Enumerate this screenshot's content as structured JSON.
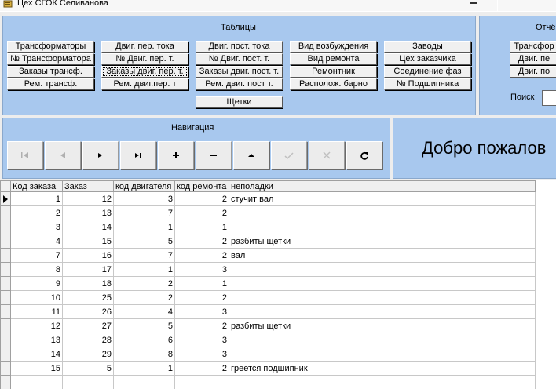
{
  "window": {
    "title": "Цех СГОК Селиванова"
  },
  "tables_group": {
    "title": "Таблицы",
    "buttons": [
      "Трансформаторы",
      "№ Трансформатора",
      "Заказы трансф.",
      "Рем. трансф.",
      "Двиг. пер. тока",
      "№ Двиг. пер. т.",
      "Заказы двиг. пер. т.",
      "Рем. двиг.пер. т",
      "Двиг. пост. тока",
      "№ Двиг. пост. т.",
      "Заказы двиг. пост. т.",
      "Рем. двиг. пост т.",
      "Вид возбуждения",
      "Вид ремонта",
      "Ремонтник",
      "Располож. барно",
      "Заводы",
      "Цех заказчика",
      "Соединение фаз",
      "№ Подшипника",
      "Щетки"
    ]
  },
  "reports_group": {
    "title": "Отчё",
    "buttons": [
      "Трансфор",
      "Двиг. пе",
      "Двиг. по"
    ],
    "search_label": "Поиск",
    "search_value": ""
  },
  "navigation": {
    "title": "Навигация",
    "buttons": [
      {
        "name": "first",
        "icon": "first-record-icon",
        "enabled": false
      },
      {
        "name": "prior",
        "icon": "prior-record-icon",
        "enabled": false
      },
      {
        "name": "next",
        "icon": "next-record-icon",
        "enabled": true
      },
      {
        "name": "last",
        "icon": "last-record-icon",
        "enabled": true
      },
      {
        "name": "insert",
        "icon": "plus-icon",
        "enabled": true
      },
      {
        "name": "delete",
        "icon": "minus-icon",
        "enabled": true
      },
      {
        "name": "edit",
        "icon": "edit-up-icon",
        "enabled": true
      },
      {
        "name": "post",
        "icon": "check-icon",
        "enabled": false
      },
      {
        "name": "cancel",
        "icon": "cancel-icon",
        "enabled": false
      },
      {
        "name": "refresh",
        "icon": "refresh-icon",
        "enabled": true
      }
    ]
  },
  "welcome": {
    "text": "Добро пожалов"
  },
  "grid": {
    "columns": [
      "Код заказа",
      "Заказ",
      "код двигателя",
      "код ремонта",
      "неполадки"
    ],
    "rows": [
      [
        "1",
        "12",
        "3",
        "2",
        "стучит вал"
      ],
      [
        "2",
        "13",
        "7",
        "2",
        ""
      ],
      [
        "3",
        "14",
        "1",
        "1",
        ""
      ],
      [
        "4",
        "15",
        "5",
        "2",
        "разбиты щетки"
      ],
      [
        "7",
        "16",
        "7",
        "2",
        "вал"
      ],
      [
        "8",
        "17",
        "1",
        "3",
        ""
      ],
      [
        "9",
        "18",
        "2",
        "1",
        ""
      ],
      [
        "10",
        "25",
        "2",
        "2",
        ""
      ],
      [
        "11",
        "26",
        "4",
        "3",
        ""
      ],
      [
        "12",
        "27",
        "5",
        "2",
        "разбиты щетки"
      ],
      [
        "13",
        "28",
        "6",
        "3",
        ""
      ],
      [
        "14",
        "29",
        "8",
        "3",
        ""
      ],
      [
        "15",
        "5",
        "1",
        "2",
        "греется подшипник"
      ]
    ],
    "current_row": 0
  },
  "colors": {
    "group_background": "#a8c8ee",
    "panel_background": "#ededed"
  }
}
